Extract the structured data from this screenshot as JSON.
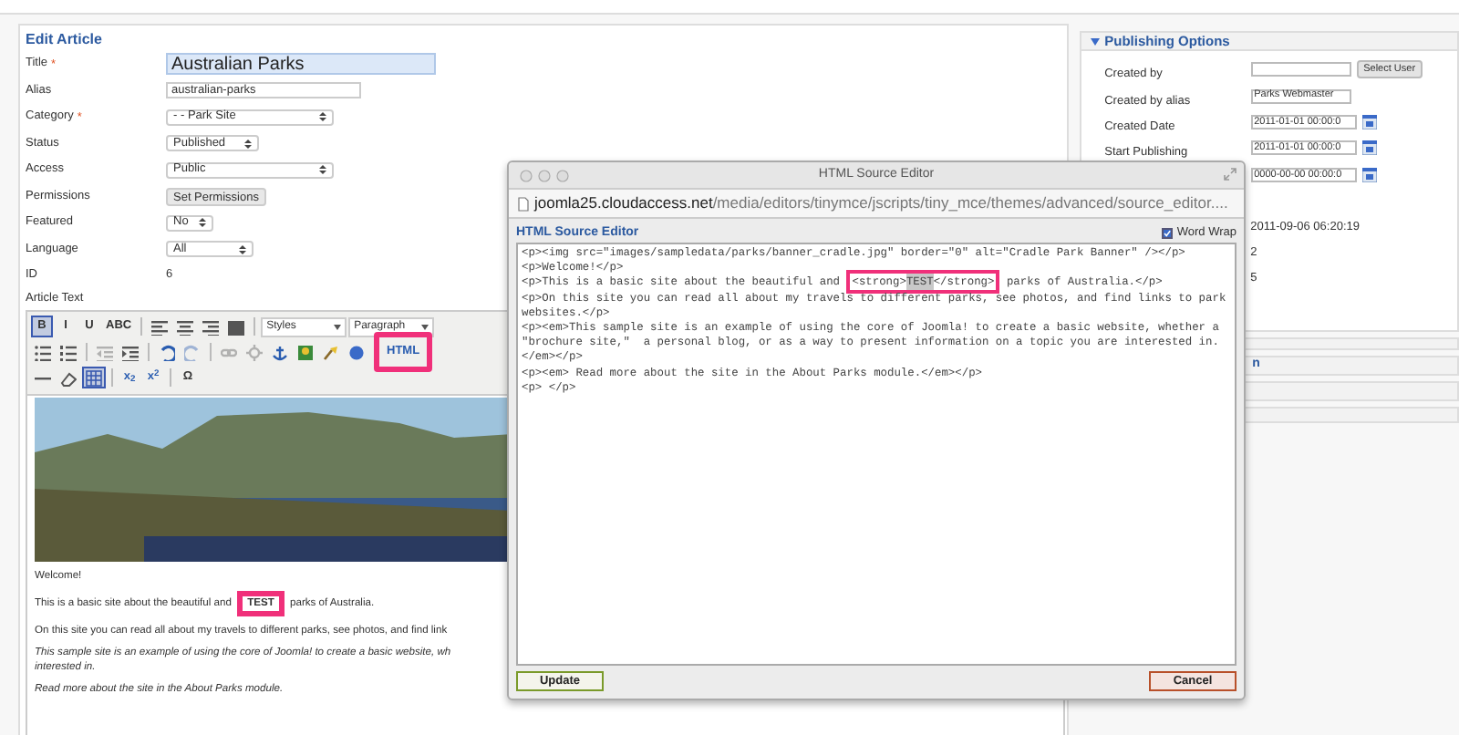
{
  "edit_article": {
    "legend": "Edit Article",
    "fields": [
      {
        "label": "Title",
        "required_mark": "*",
        "kind": "text",
        "value": "Australian Parks",
        "focused": true
      },
      {
        "label": "Alias",
        "kind": "text",
        "value": "australian-parks",
        "focused": false
      },
      {
        "label": "Category",
        "required_mark": "*",
        "kind": "select",
        "value": "- - Park Site"
      },
      {
        "label": "Status",
        "kind": "select",
        "value": "Published"
      },
      {
        "label": "Access",
        "kind": "select",
        "value": "Public"
      },
      {
        "label": "Permissions",
        "kind": "button",
        "value": "Set Permissions"
      },
      {
        "label": "Featured",
        "kind": "select",
        "value": "No"
      },
      {
        "label": "Language",
        "kind": "select",
        "value": "All"
      },
      {
        "label": "ID",
        "kind": "static",
        "value": "6"
      }
    ],
    "article_text_label": "Article Text",
    "toolbar_rows": [
      [
        {
          "kind": "text",
          "label": "B",
          "active": true,
          "disabled": false,
          "annotated": false
        },
        {
          "kind": "text",
          "label": "I",
          "active": false,
          "disabled": false,
          "annotated": false
        },
        {
          "kind": "text",
          "label": "U",
          "active": false,
          "disabled": false,
          "annotated": false
        },
        {
          "kind": "text",
          "label": "ABC",
          "active": false,
          "disabled": false,
          "annotated": false
        },
        {
          "kind": "sep"
        },
        {
          "kind": "align-left",
          "active": false,
          "disabled": false,
          "annotated": false
        },
        {
          "kind": "align-center",
          "active": false,
          "disabled": false,
          "annotated": false
        },
        {
          "kind": "align-right",
          "active": false,
          "disabled": false,
          "annotated": false
        },
        {
          "kind": "justify",
          "active": false,
          "disabled": false,
          "annotated": false
        },
        {
          "kind": "sep"
        },
        {
          "kind": "select",
          "label": "Styles"
        },
        {
          "kind": "select",
          "label": "Paragraph"
        }
      ],
      [
        {
          "kind": "bullet-list",
          "active": false,
          "disabled": false,
          "annotated": false
        },
        {
          "kind": "numbered-list",
          "active": false,
          "disabled": false,
          "annotated": false
        },
        {
          "kind": "sep"
        },
        {
          "kind": "outdent",
          "active": false,
          "disabled": true,
          "annotated": false
        },
        {
          "kind": "indent",
          "active": false,
          "disabled": false,
          "annotated": false
        },
        {
          "kind": "sep"
        },
        {
          "kind": "undo",
          "active": false,
          "disabled": false,
          "annotated": false
        },
        {
          "kind": "redo",
          "active": false,
          "disabled": true,
          "annotated": false
        },
        {
          "kind": "sep"
        },
        {
          "kind": "link",
          "active": false,
          "disabled": true,
          "annotated": false
        },
        {
          "kind": "unlink",
          "active": false,
          "disabled": true,
          "annotated": false
        },
        {
          "kind": "anchor",
          "active": false,
          "disabled": false,
          "annotated": false
        },
        {
          "kind": "image",
          "active": false,
          "disabled": false,
          "annotated": false
        },
        {
          "kind": "cleanup",
          "active": false,
          "disabled": false,
          "annotated": false
        },
        {
          "kind": "help",
          "active": false,
          "disabled": false,
          "annotated": false
        },
        {
          "kind": "text",
          "label": "HTML",
          "active": false,
          "disabled": false,
          "annotated": true
        }
      ],
      [
        {
          "kind": "rule",
          "active": false,
          "disabled": false,
          "annotated": false
        },
        {
          "kind": "eraser",
          "active": false,
          "disabled": false,
          "annotated": false
        },
        {
          "kind": "table",
          "active": true,
          "disabled": false,
          "annotated": false
        },
        {
          "kind": "sep"
        },
        {
          "kind": "text",
          "label": "x$_{2}$",
          "active": false,
          "disabled": false,
          "annotated": false
        },
        {
          "kind": "text",
          "label": "x$^{2}$",
          "active": false,
          "disabled": false,
          "annotated": false
        },
        {
          "kind": "sep"
        },
        {
          "kind": "text",
          "label": "Ω",
          "active": false,
          "disabled": false,
          "annotated": false
        }
      ]
    ],
    "content": [
      {
        "kind": "image"
      },
      {
        "kind": "paragraph",
        "italic": false,
        "lines": [
          "Welcome!"
        ]
      },
      {
        "kind": "paragraph",
        "italic": false,
        "lines": [
          "This is a basic site about the beautiful and **TEST** parks of Australia."
        ]
      },
      {
        "kind": "paragraph",
        "italic": false,
        "lines": [
          "On this site you can read all about my travels to different parks, see photos, and find link"
        ]
      },
      {
        "kind": "paragraph",
        "italic": true,
        "lines": [
          "This sample site is an example of using the core of Joomla! to create a basic website, wh",
          "interested in."
        ]
      },
      {
        "kind": "paragraph",
        "italic": true,
        "lines": [
          "Read more about the site in the About Parks module."
        ]
      }
    ]
  },
  "publishing_options": {
    "title": "Publishing Options",
    "expanded": true,
    "fields": [
      {
        "label": "Created by",
        "kind": "user",
        "button": "Select User"
      },
      {
        "label": "Created by alias",
        "kind": "text",
        "value": "Parks Webmaster"
      },
      {
        "label": "Created Date",
        "kind": "date",
        "value": "2011-01-01 00:00:0"
      },
      {
        "label": "Start Publishing",
        "kind": "date",
        "value": "2011-01-01 00:00:0"
      },
      {
        "kind": "date",
        "value": "0000-00-00 00:00:0"
      },
      {
        "kind": "spacer"
      },
      {
        "kind": "static",
        "value": "2011-09-06 06:20:19"
      },
      {
        "kind": "static",
        "value": "2"
      },
      {
        "kind": "static",
        "value": "5"
      }
    ]
  },
  "collapsed_panels": [
    {
      "title": "n"
    }
  ],
  "dialog": {
    "window_title": "HTML Source Editor",
    "url_host": "joomla25.cloudaccess.net",
    "url_path": "/media/editors/tinymce/jscripts/tiny_mce/themes/advanced/source_editor....",
    "heading": "HTML Source Editor",
    "word_wrap": {
      "label": "Word Wrap",
      "checked": true
    },
    "code_lines": [
      [
        {
          "text": "<p><img src=\"images/sampledata/parks/banner_cradle.jpg\" border=\"0\" alt=\"Cradle Park Banner\" /></p>",
          "selected": false,
          "boxed": false
        }
      ],
      [
        {
          "text": "<p>Welcome!</p>",
          "selected": false,
          "boxed": false
        }
      ],
      [
        {
          "text": "<p>This is a basic site about the beautiful and ",
          "selected": false,
          "boxed": false
        },
        {
          "text": "<strong>",
          "selected": false,
          "boxed": true
        },
        {
          "text": "TEST",
          "selected": true,
          "boxed": true
        },
        {
          "text": "</strong>",
          "selected": false,
          "boxed": true
        },
        {
          "text": " parks of Australia.</p>",
          "selected": false,
          "boxed": false
        }
      ],
      [
        {
          "text": "<p>On this site you can read all about my travels to different parks, see photos, and find links to park websites.</p>",
          "selected": false,
          "boxed": false
        }
      ],
      [
        {
          "text": "<p><em>This sample site is an example of using the core of Joomla! to create a basic website, whether a \"brochure site,\"  a personal blog, or as a way to present information on a topic you are interested in.</em></p>",
          "selected": false,
          "boxed": false
        }
      ],
      [
        {
          "text": "<p><em> Read more about the site in the About Parks module.</em></p>",
          "selected": false,
          "boxed": false
        }
      ],
      [
        {
          "text": "<p> </p>",
          "selected": false,
          "boxed": false
        }
      ]
    ],
    "buttons": [
      {
        "label": "Update",
        "kind": "primary"
      },
      {
        "label": "Cancel",
        "kind": "cancel"
      }
    ]
  }
}
